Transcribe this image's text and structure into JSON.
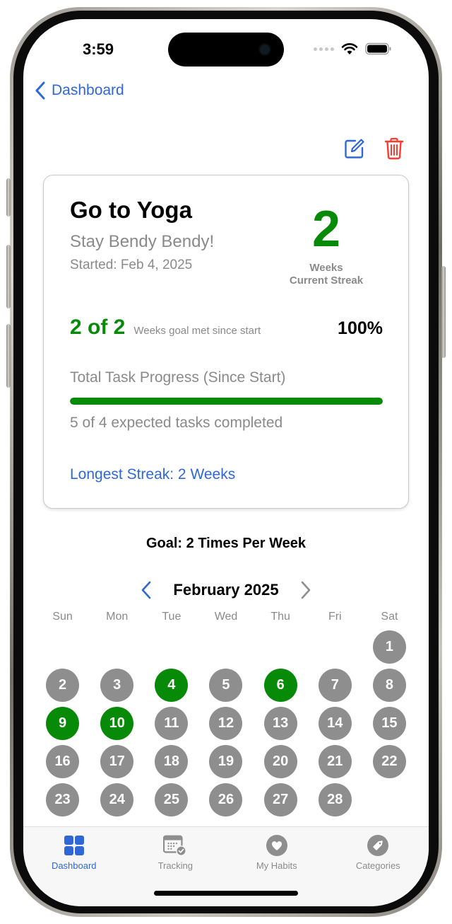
{
  "status_bar": {
    "time": "3:59"
  },
  "nav": {
    "back_label": "Dashboard"
  },
  "toolbar": {
    "edit_icon": "square-pencil-icon",
    "delete_icon": "trash-icon"
  },
  "habit": {
    "title": "Go to Yoga",
    "subtitle": "Stay Bendy Bendy!",
    "started": "Started: Feb 4, 2025",
    "current_streak": "2",
    "streak_unit": "Weeks",
    "streak_label": "Current Streak",
    "weeks_met": "2 of 2",
    "weeks_met_label": "Weeks goal met since start",
    "weeks_met_percent": "100%",
    "progress_title": "Total Task Progress (Since Start)",
    "progress_fraction": 1.0,
    "progress_caption": "5 of 4 expected tasks completed",
    "longest_streak": "Longest Streak: 2 Weeks"
  },
  "goal": "Goal: 2 Times Per Week",
  "calendar": {
    "month_label": "February 2025",
    "weekdays": [
      "Sun",
      "Mon",
      "Tue",
      "Wed",
      "Thu",
      "Fri",
      "Sat"
    ],
    "leading_blanks": 6,
    "days": [
      "1",
      "2",
      "3",
      "4",
      "5",
      "6",
      "7",
      "8",
      "9",
      "10",
      "11",
      "12",
      "13",
      "14",
      "15",
      "16",
      "17",
      "18",
      "19",
      "20",
      "21",
      "22",
      "23",
      "24",
      "25",
      "26",
      "27",
      "28"
    ],
    "completed_days": [
      "4",
      "6",
      "9",
      "10"
    ]
  },
  "colors": {
    "accent": "#2f68d6",
    "success": "#078a07",
    "danger": "#ff3b30",
    "inactive": "#8e8e8e"
  },
  "tabbar": {
    "tabs": [
      {
        "label": "Dashboard",
        "icon": "grid-icon",
        "active": true
      },
      {
        "label": "Tracking",
        "icon": "calendar-check-icon",
        "active": false
      },
      {
        "label": "My Habits",
        "icon": "heart-circle-icon",
        "active": false
      },
      {
        "label": "Categories",
        "icon": "tag-circle-icon",
        "active": false
      }
    ]
  }
}
